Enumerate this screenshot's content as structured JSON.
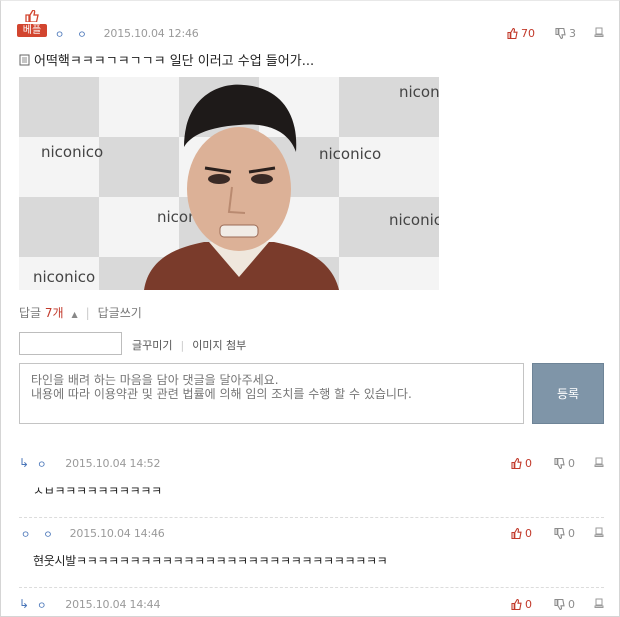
{
  "post": {
    "best_label": "베플",
    "author": "ㅇ ㅇ",
    "time": "2015.10.04 12:46",
    "upvotes": "70",
    "downvotes": "3",
    "title": "어떡핵ㅋㅋㅋㄱㅋㄱㄱㅋ 일단 이러고 수업 들어가...",
    "image_watermark": "niconico"
  },
  "reply_bar": {
    "label": "답글",
    "count": "7개",
    "write": "답글쓰기"
  },
  "compose": {
    "deco_tool": "글꾸미기",
    "attach_image": "이미지 첨부",
    "placeholder": "타인을 배려 하는 마음을 담아 댓글을 달아주세요.\n내용에 따라 이용약관 및 관련 법률에 의해 임의 조치를 수행 할 수 있습니다.",
    "submit": "등록"
  },
  "comments": [
    {
      "author": "ㅇ",
      "time": "2015.10.04 14:52",
      "up": "0",
      "down": "0",
      "text": "ㅅㅂㅋㅋㅋㅋㅋㅋㅋㅋㅋㅋ"
    },
    {
      "author": "ㅇ ㅇ",
      "time": "2015.10.04 14:46",
      "up": "0",
      "down": "0",
      "text": "현웃시발ㅋㅋㅋㅋㅋㅋㅋㅋㅋㅋㅋㅋㅋㅋㅋㅋㅋㅋㅋㅋㅋㅋㅋㅋㅋㅋㅋㅋㅋ"
    },
    {
      "author": "ㅇ",
      "time": "2015.10.04 14:44",
      "up": "0",
      "down": "0",
      "text": ""
    }
  ],
  "colors": {
    "accent_red": "#c23a2b",
    "badge_red": "#d2452f",
    "nick_blue": "#4a76b9",
    "button_gray": "#7f95a8"
  }
}
